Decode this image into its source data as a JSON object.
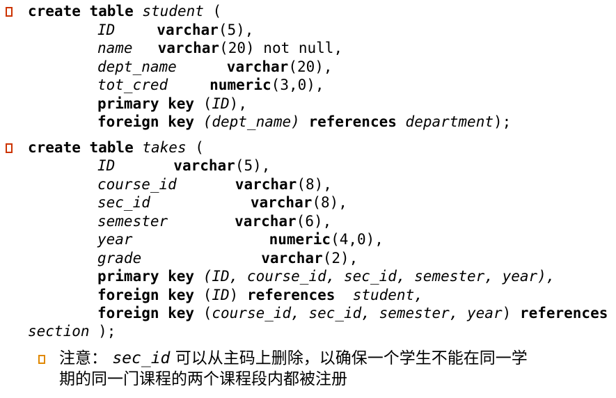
{
  "block1": {
    "create": "create table",
    "table": "student",
    "paren_open": " (",
    "id_field": "ID",
    "id_type": "varchar",
    "id_args": "(5),",
    "name_field": "name",
    "name_type": "varchar",
    "name_args": "(20) not null,",
    "dept_field": "dept_name",
    "dept_type": "varchar",
    "dept_args": "(20),",
    "tot_field": "tot_cred",
    "tot_type": "numeric",
    "tot_args": "(3,0),",
    "pk_kw": "primary key",
    "pk_open": " (",
    "pk_col": "ID",
    "pk_close": "),",
    "fk_kw": "foreign key",
    "fk_col": " (dept_name)",
    "refs_kw": "references",
    "fk_ref": "department",
    "fk_end": ");"
  },
  "block2": {
    "create": "create table",
    "table": "takes",
    "paren_open": " (",
    "id_field": "ID",
    "id_type": "varchar",
    "id_args": "(5),",
    "course_field": "course_id",
    "course_type": "varchar",
    "course_args": "(8),",
    "sec_field": "sec_id",
    "sec_type": "varchar",
    "sec_args": "(8),",
    "sem_field": "semester",
    "sem_type": "varchar",
    "sem_args": "(6),",
    "year_field": "year",
    "year_type": "numeric",
    "year_args": "(4,0),",
    "grade_field": "grade",
    "grade_type": "varchar",
    "grade_args": "(2),",
    "pk_kw": "primary key",
    "pk_cols": " (ID, course_id, sec_id, semester, year),",
    "fk1_kw": "foreign key",
    "fk1_open": " (",
    "fk1_col": "ID",
    "fk1_close": ")",
    "fk1_refs": "references",
    "fk1_ref": "student,",
    "fk2_kw": "foreign key",
    "fk2_open": " (",
    "fk2_cols": "course_id, sec_id, semester, year",
    "fk2_close": ")",
    "fk2_refs": "references",
    "fk2_ref": "section",
    "fk2_end": " );"
  },
  "note": {
    "prefix": "注意：",
    "field": "sec_id",
    "text1": "可以从主码上删除，以确保一个学生不能在同一学",
    "text2": "期的同一门课程的两个课程段内都被注册"
  },
  "colors": {
    "bullet": "#cc3300",
    "sub_bullet": "#e08800"
  }
}
